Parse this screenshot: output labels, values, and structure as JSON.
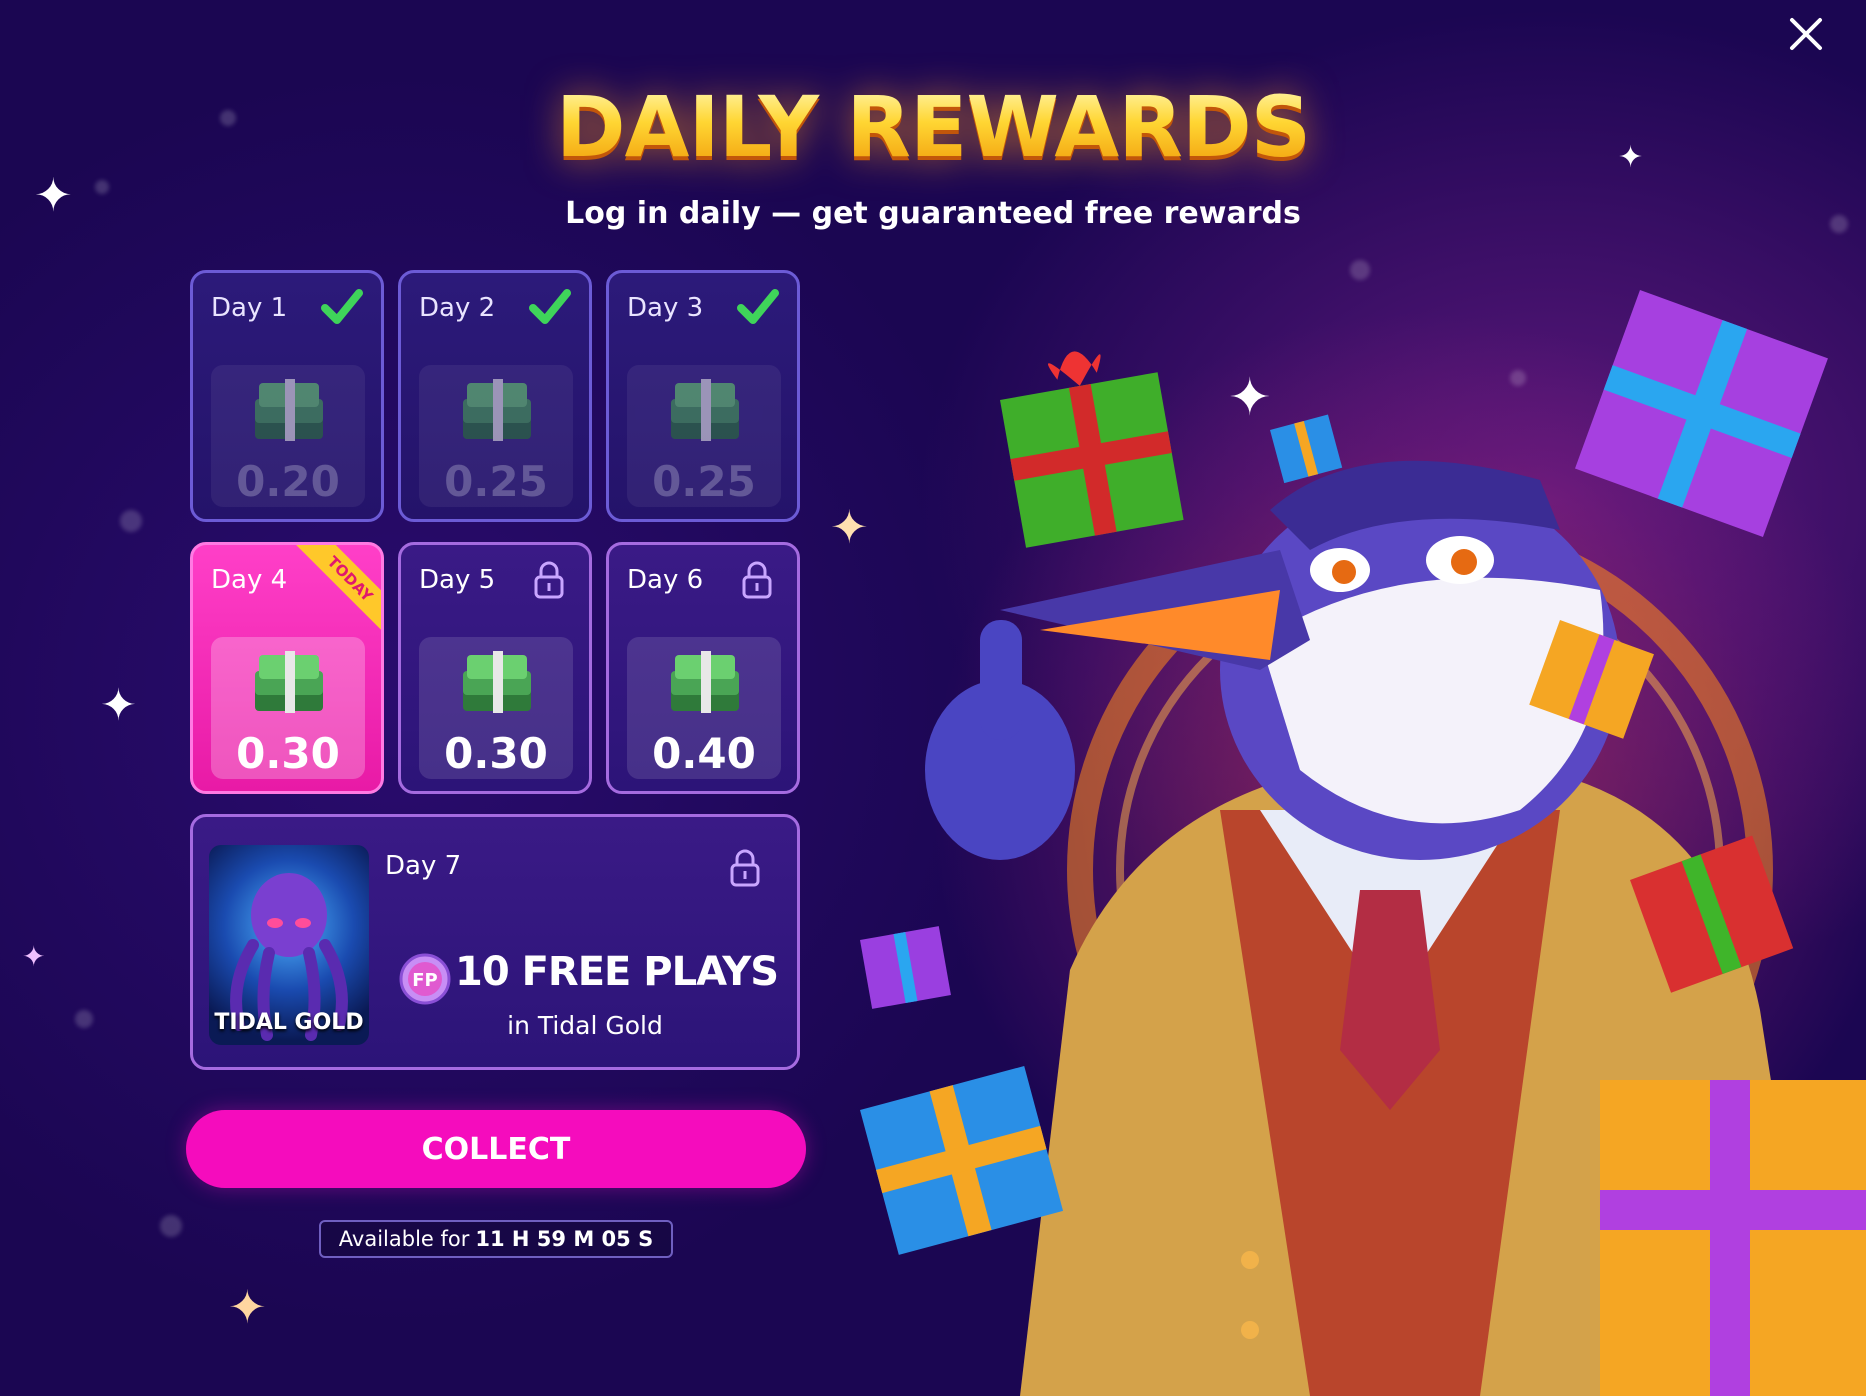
{
  "title": "DAILY REWARDS",
  "subtitle": "Log in daily — get guaranteed free rewards",
  "days": [
    {
      "label": "Day 1",
      "amount": "0.20",
      "status": "claimed"
    },
    {
      "label": "Day 2",
      "amount": "0.25",
      "status": "claimed"
    },
    {
      "label": "Day 3",
      "amount": "0.25",
      "status": "claimed"
    },
    {
      "label": "Day 4",
      "amount": "0.30",
      "status": "today",
      "badge": "TODAY"
    },
    {
      "label": "Day 5",
      "amount": "0.30",
      "status": "locked"
    },
    {
      "label": "Day 6",
      "amount": "0.40",
      "status": "locked"
    }
  ],
  "day7": {
    "label": "Day 7",
    "game_title": "TIDAL GOLD",
    "reward": "10 FREE PLAYS",
    "reward_sub": "in Tidal Gold",
    "badge_text": "FP",
    "status": "locked"
  },
  "collect_label": "COLLECT",
  "timer": {
    "prefix": "Available for",
    "value": "11 H 59 M 05 S"
  },
  "icons": {
    "close": "close-icon",
    "claimed": "checkmark-icon",
    "locked": "lock-icon",
    "cash": "cash-stack-icon",
    "free_plays": "free-plays-coin-icon"
  },
  "colors": {
    "accent": "#f50cbd",
    "today_card": "#ff3fc8",
    "title_gold": "#ffd23a",
    "check_green": "#3fd45a",
    "background": "#1d0754"
  }
}
